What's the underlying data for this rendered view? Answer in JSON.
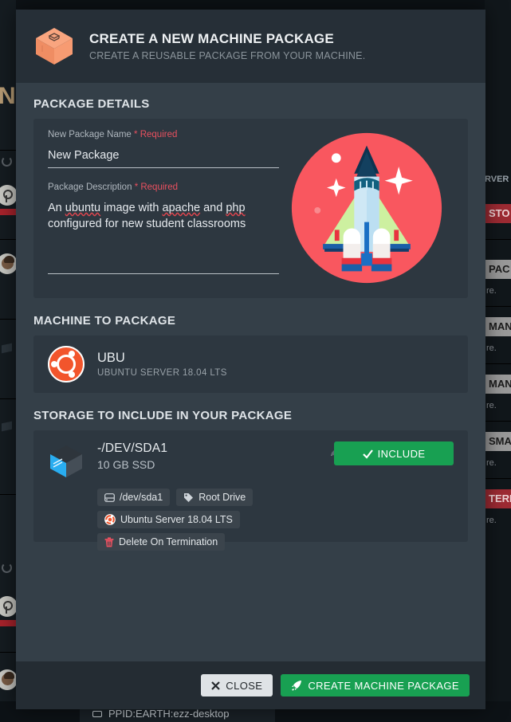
{
  "modal": {
    "header": {
      "icon": "package-box-icon",
      "title": "CREATE A NEW MACHINE PACKAGE",
      "subtitle": "CREATE A REUSABLE PACKAGE FROM YOUR MACHINE."
    },
    "sections": {
      "details": {
        "title": "PACKAGE DETAILS",
        "name_label": "New Package Name",
        "name_required": "* Required",
        "name_value": "New Package",
        "name_placeholder": "New Package",
        "desc_label": "Package Description",
        "desc_required": "* Required",
        "desc_line1_a": "An ",
        "desc_line1_b": "ubuntu",
        "desc_line1_c": " image with ",
        "desc_line1_d": "apache",
        "desc_line1_e": " and ",
        "desc_line1_f": "php",
        "desc_line2": "configured for new student classrooms",
        "illustration": "space-shuttle-illustration"
      },
      "machine": {
        "title": "MACHINE TO PACKAGE",
        "icon": "ubuntu-logo-icon",
        "name": "UBU",
        "os": "UBUNTU SERVER 18.04 LTS"
      },
      "storage": {
        "title": "STORAGE TO INCLUDE IN YOUR PACKAGE",
        "icon": "disk-box-icon",
        "device": "-/DEV/SDA1",
        "size": "10 GB SSD",
        "edit_icon": "pencil-icon",
        "include_label": "INCLUDE",
        "include_icon": "check-icon",
        "include_color": "#18a052",
        "badges": [
          {
            "icon": "hard-drive-icon",
            "label": "/dev/sda1"
          },
          {
            "icon": "tag-icon",
            "label": "Root Drive"
          },
          {
            "icon": "ubuntu-icon",
            "label": "Ubuntu Server 18.04 LTS"
          },
          {
            "icon": "trash-icon",
            "label": "Delete On Termination"
          }
        ]
      }
    },
    "footer": {
      "close_label": "CLOSE",
      "close_icon": "x-icon",
      "create_label": "CREATE MACHINE PACKAGE",
      "create_icon": "rocket-icon"
    }
  },
  "background": {
    "rail_letter": "N",
    "right_chips": [
      {
        "label": "STO",
        "style": "red"
      },
      {
        "label": "PAC",
        "style": "gray"
      },
      {
        "label": "MAN",
        "style": "gray"
      },
      {
        "label": "MAN",
        "style": "gray"
      },
      {
        "label": "SMA",
        "style": "gray"
      },
      {
        "label": "TERM",
        "style": "red"
      }
    ],
    "right_subs": [
      "re.",
      "re.",
      "re.",
      "re.",
      "re."
    ],
    "right_server_label": "RVER",
    "bottom_card_label": "PPID:EARTH:ezz-desktop"
  },
  "colors": {
    "modal_body": "#344049",
    "modal_header": "#262f37",
    "card": "#2d3740",
    "accent_green": "#18a052",
    "required_red": "#e8505f",
    "ubuntu_orange": "#f2552c",
    "illustration_bg": "#f9575f"
  }
}
